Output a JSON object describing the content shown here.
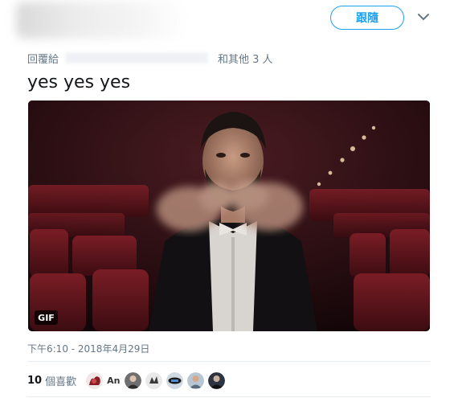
{
  "header": {
    "follow_label": "跟隨",
    "caret_icon": "chevron-down-icon"
  },
  "reply": {
    "prefix": "回覆給",
    "suffix": "和其他 3 人"
  },
  "tweet": {
    "text": "yes yes yes",
    "media_badge": "GIF",
    "timestamp": "下午6:10 - 2018年4月29日"
  },
  "likes": {
    "count": "10",
    "label": "個喜歡",
    "avatar_text": "An"
  },
  "colors": {
    "accent": "#1da1f2",
    "muted": "#657786",
    "divider": "#e6ecf0"
  }
}
